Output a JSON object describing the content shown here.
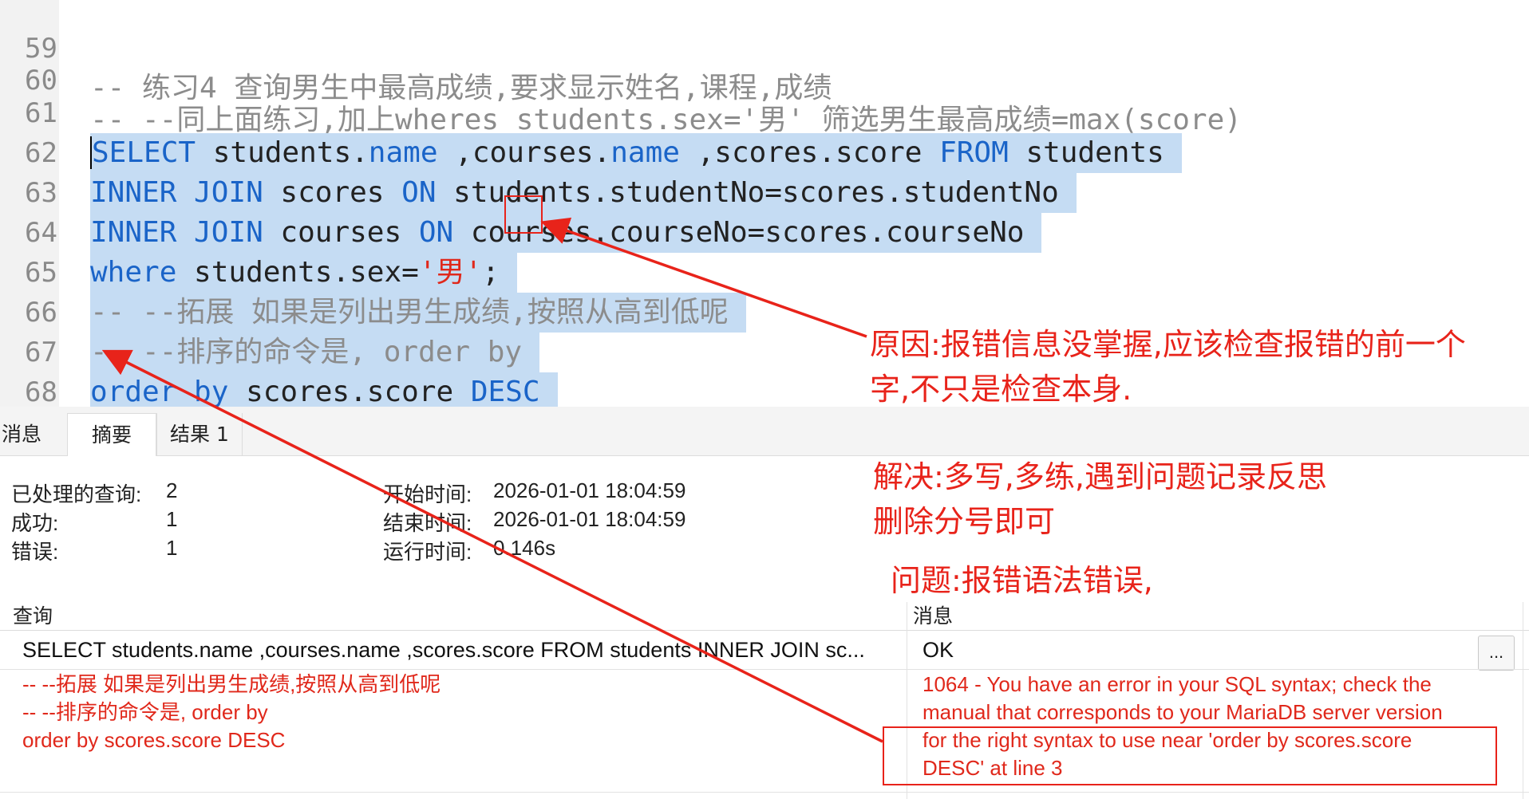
{
  "editor": {
    "lines": [
      {
        "num": "59",
        "text": "-- 练习4 查询男生中最高成绩,要求显示姓名,课程,成绩"
      },
      {
        "num": "60",
        "text": "-- --同上面练习,加上wheres students.sex='男' 筛选男生最高成绩=max(score)"
      },
      {
        "num": "61",
        "kw1": "SELECT",
        "t1": " students.",
        "kw2": "name",
        "t2": " ,courses.",
        "kw3": "name",
        "t3": " ,scores.score ",
        "kw4": "FROM",
        "t4": " students"
      },
      {
        "num": "62",
        "kw1": "INNER JOIN",
        "t1": " scores ",
        "kw2": "ON",
        "t2": " students.studentNo=scores.studentNo"
      },
      {
        "num": "63",
        "kw1": "INNER JOIN",
        "t1": " courses ",
        "kw2": "ON",
        "t2": " courses.courseNo=scores.courseNo"
      },
      {
        "num": "64",
        "kw1": "where",
        "t1": " students.sex=",
        "st1": "'男'",
        "t2": ";"
      },
      {
        "num": "65",
        "text": "-- --拓展 如果是列出男生成绩,按照从高到低呢"
      },
      {
        "num": "66",
        "text": "-- --排序的命令是, order by"
      },
      {
        "num": "67",
        "kw1": "order by",
        "t1": " scores.score ",
        "kw2": "DESC"
      },
      {
        "num": "68",
        "text": ""
      }
    ]
  },
  "tabs": [
    {
      "label": "消息"
    },
    {
      "label": "摘要"
    },
    {
      "label": "结果 1"
    }
  ],
  "summary": {
    "processed_label": "已处理的查询:",
    "processed_value": "2",
    "success_label": "成功:",
    "success_value": "1",
    "error_label": "错误:",
    "error_value": "1",
    "start_label": "开始时间:",
    "start_value": "2026-01-01 18:04:59",
    "end_label": "结束时间:",
    "end_value": "2026-01-01 18:04:59",
    "run_label": "运行时间:",
    "run_value": "0.146s"
  },
  "results": {
    "col_query": "查询",
    "col_message": "消息",
    "row1": {
      "query": "SELECT students.name ,courses.name ,scores.score FROM students INNER JOIN sc...",
      "message": "OK",
      "more": "..."
    },
    "row2": {
      "query_lines": [
        "-- --拓展 如果是列出男生成绩,按照从高到低呢",
        "-- --排序的命令是, order by",
        "order by scores.score DESC"
      ],
      "message_lines": [
        "1064 - You have an error in your SQL syntax; check the",
        "manual that corresponds to your MariaDB server version",
        "for the right syntax to use near 'order by scores.score",
        "DESC' at line 3"
      ]
    }
  },
  "annotations": {
    "cause_line1": "原因:报错信息没掌握,应该检查报错的前一个",
    "cause_line2": "字,不只是检查本身.",
    "solution_line1": "解决:多写,多练,遇到问题记录反思",
    "solution_line2": "删除分号即可",
    "problem": "问题:报错语法错误,"
  },
  "colors": {
    "keyword": "#1a64c8",
    "comment": "#8c8c8c",
    "string": "#e0281b",
    "selection": "#c5dcf3",
    "annotation_red": "#e8231a"
  }
}
